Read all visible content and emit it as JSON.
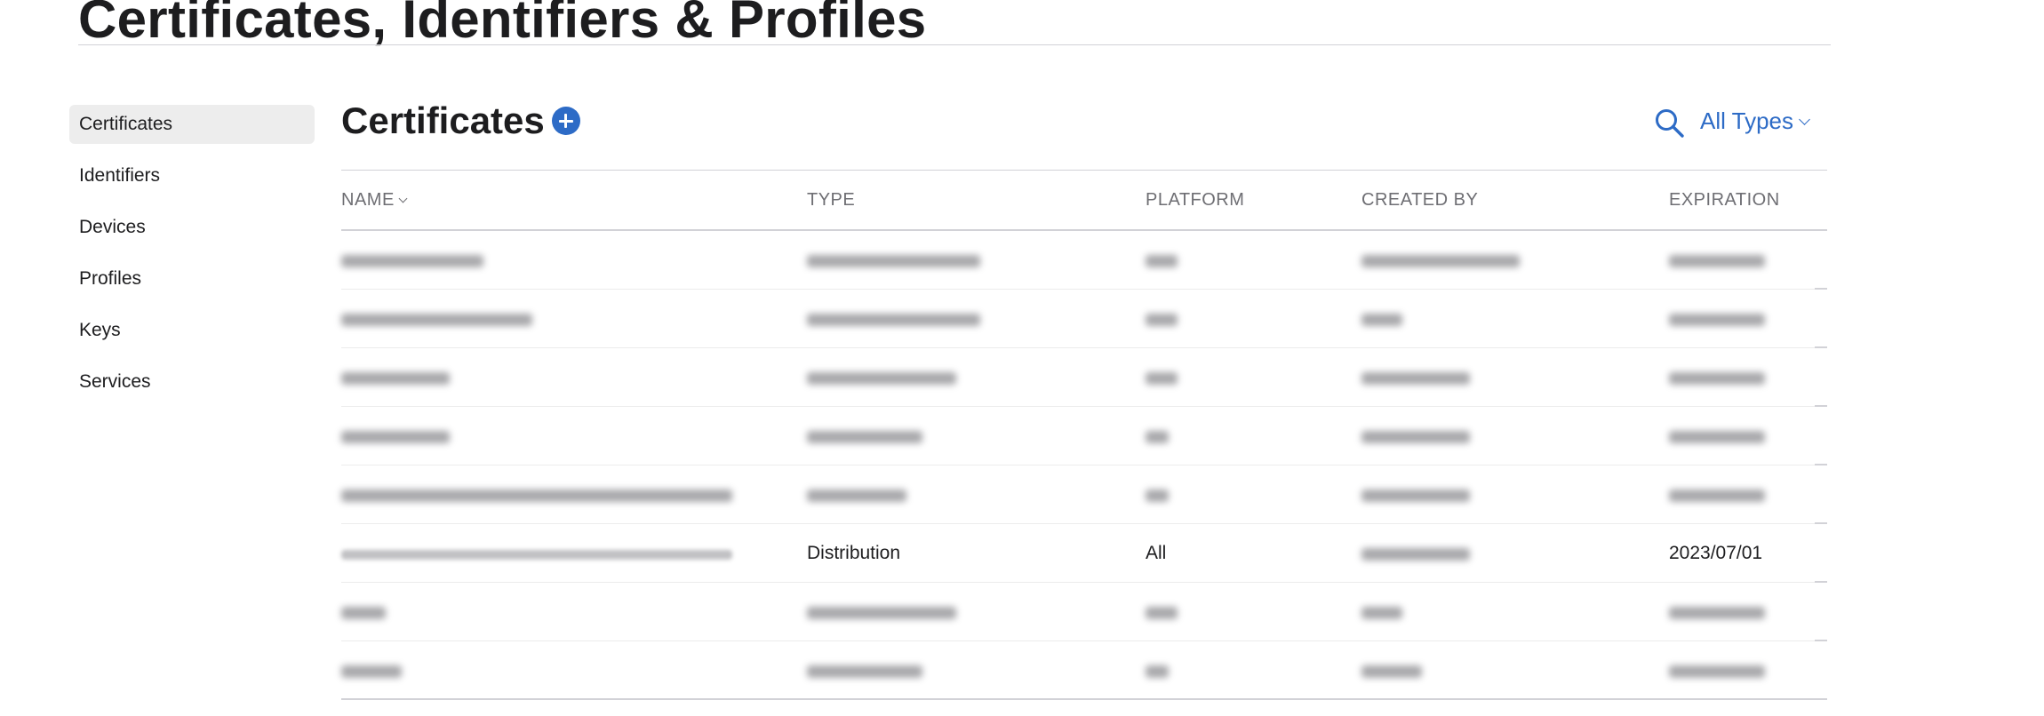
{
  "page": {
    "title": "Certificates, Identifiers & Profiles"
  },
  "sidebar": {
    "items": [
      {
        "label": "Certificates",
        "active": true
      },
      {
        "label": "Identifiers"
      },
      {
        "label": "Devices"
      },
      {
        "label": "Profiles"
      },
      {
        "label": "Keys"
      },
      {
        "label": "Services"
      }
    ]
  },
  "section": {
    "title": "Certificates",
    "add_icon": "plus-circle-icon",
    "search_icon": "search-icon",
    "filter_label": "All Types",
    "accent_color": "#2d6bc6"
  },
  "table": {
    "columns": [
      "NAME",
      "TYPE",
      "PLATFORM",
      "CREATED BY",
      "EXPIRATION"
    ],
    "rows": [
      {
        "name": "",
        "type": "",
        "platform": "",
        "created_by": "",
        "expiration": "",
        "redacted": true
      },
      {
        "name": "",
        "type": "",
        "platform": "",
        "created_by": "",
        "expiration": "",
        "redacted": true
      },
      {
        "name": "",
        "type": "",
        "platform": "",
        "created_by": "",
        "expiration": "",
        "redacted": true
      },
      {
        "name": "",
        "type": "",
        "platform": "",
        "created_by": "",
        "expiration": "",
        "redacted": true
      },
      {
        "name": "",
        "type": "",
        "platform": "",
        "created_by": "",
        "expiration": "",
        "redacted": true
      },
      {
        "name": "",
        "type": "Distribution",
        "platform": "All",
        "created_by": "",
        "expiration": "2023/07/01",
        "redacted": false
      },
      {
        "name": "",
        "type": "",
        "platform": "",
        "created_by": "",
        "expiration": "",
        "redacted": true
      },
      {
        "name": "",
        "type": "",
        "platform": "",
        "created_by": "",
        "expiration": "",
        "redacted": true
      }
    ]
  }
}
